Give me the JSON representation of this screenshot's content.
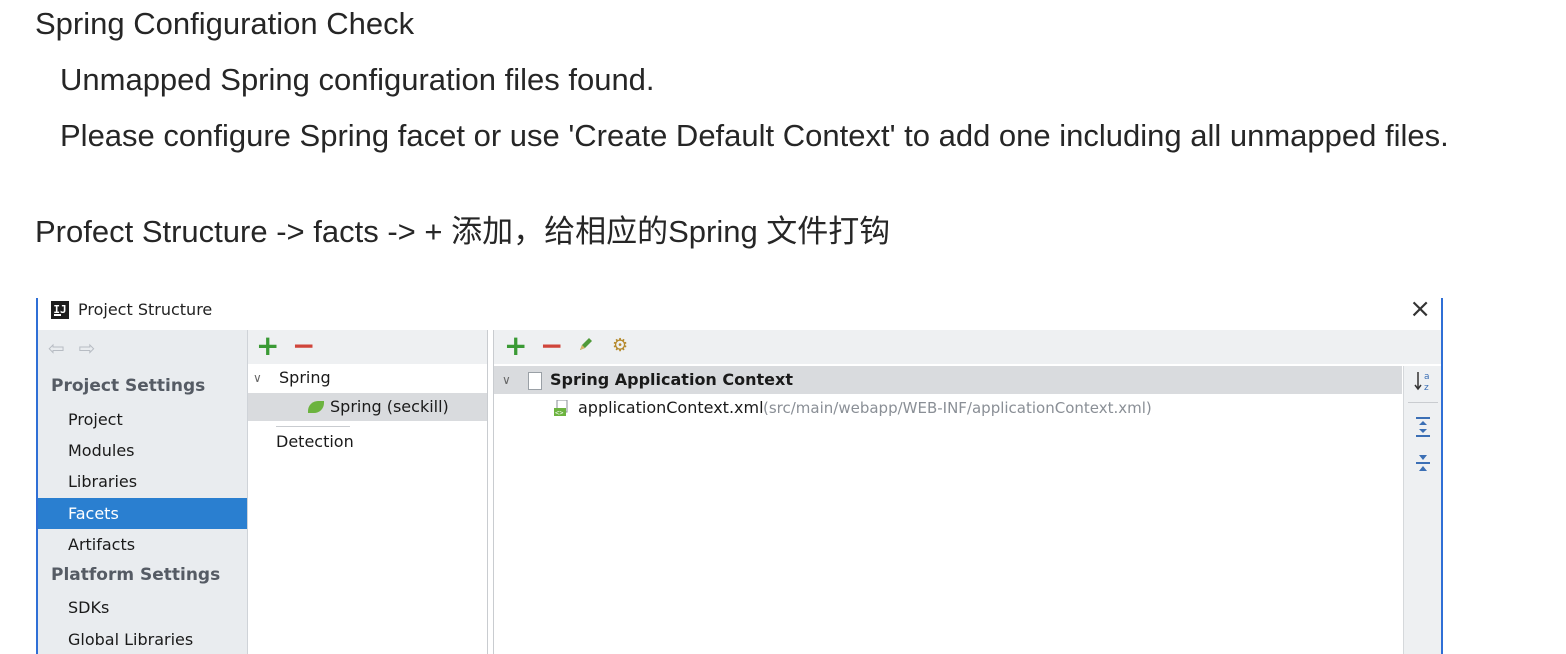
{
  "article": {
    "heading": "Spring Configuration Check",
    "line1": "Unmapped Spring configuration files found.",
    "line2": "Please configure Spring facet or use 'Create Default Context' to add one including all unmapped files.",
    "instruction": "Profect Structure -> facts -> + 添加，给相应的Spring 文件打钩"
  },
  "dialog": {
    "title": "Project Structure",
    "close_glyph": "×",
    "sidebar": {
      "back_glyph": "⇦",
      "forward_glyph": "⇨",
      "project_settings_header": "Project Settings",
      "project_settings_items": [
        "Project",
        "Modules",
        "Libraries",
        "Facets",
        "Artifacts"
      ],
      "platform_settings_header": "Platform Settings",
      "platform_settings_items": [
        "SDKs",
        "Global Libraries"
      ],
      "active_item": "Facets"
    },
    "facets_panel": {
      "add_glyph": "+",
      "remove_glyph": "−",
      "tree_root": "Spring",
      "tree_child": "Spring (seckill)",
      "detection": "Detection"
    },
    "context_panel": {
      "add_glyph": "+",
      "remove_glyph": "−",
      "context_name": "Spring Application Context",
      "file_name": "applicationContext.xml",
      "file_path": "(src/main/webapp/WEB-INF/applicationContext.xml)",
      "sort_glyph": "↓a z",
      "icons": [
        "pencil-icon",
        "wrench-icon",
        "sort-alpha-icon",
        "expand-all-icon",
        "collapse-all-icon"
      ]
    },
    "colors": {
      "accent": "#2a7fd0",
      "add": "#3a9a35",
      "remove": "#d0453b",
      "border": "#2f6fd6"
    }
  }
}
